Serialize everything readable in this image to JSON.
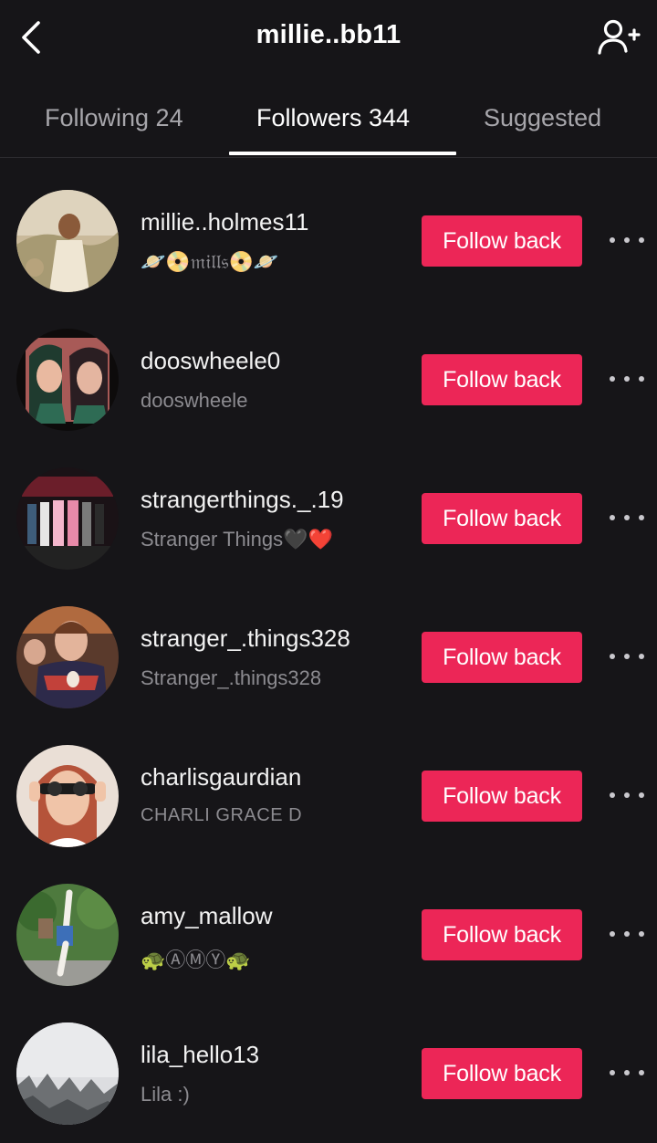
{
  "header": {
    "title": "millie..bb11",
    "back_icon": "chevron-left-icon",
    "add_friend_icon": "add-person-icon"
  },
  "tabs": [
    {
      "label": "Following 24",
      "active": false
    },
    {
      "label": "Followers 344",
      "active": true
    },
    {
      "label": "Suggested",
      "active": false
    }
  ],
  "colors": {
    "background": "#161518",
    "follow_button": "#ec2657",
    "secondary_text": "#8c8b90"
  },
  "followers": [
    {
      "username": "millie..holmes11",
      "nickname": "🪐📀𝔪𝔦𝔩𝔩𝔰📀🪐",
      "button": "Follow back"
    },
    {
      "username": "dooswheele0",
      "nickname": "dooswheele",
      "button": "Follow back"
    },
    {
      "username": "strangerthings._.19",
      "nickname": "Stranger Things🖤❤️",
      "button": "Follow back"
    },
    {
      "username": "stranger_.things328",
      "nickname": "Stranger_.things328",
      "button": "Follow back"
    },
    {
      "username": "charlisgaurdian",
      "nickname": "CHARLI GRACE D",
      "button": "Follow back"
    },
    {
      "username": "amy_mallow",
      "nickname": "🐢ⒶⓂⓎ🐢",
      "button": "Follow back"
    },
    {
      "username": "lila_hello13",
      "nickname": "Lila :)",
      "button": "Follow back"
    }
  ]
}
